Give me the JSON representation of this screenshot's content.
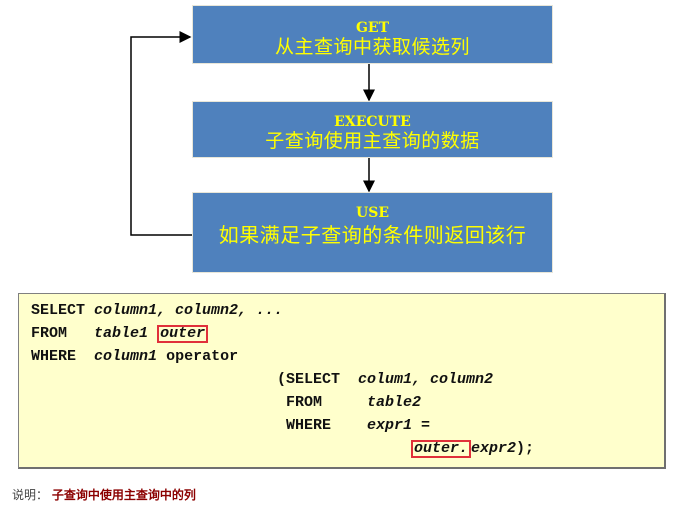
{
  "flow": {
    "steps": [
      {
        "keyword": "GET",
        "description": "从主查询中获取候选列"
      },
      {
        "keyword": "EXECUTE",
        "description": "子查询使用主查询的数据"
      },
      {
        "keyword": "USE",
        "description": "如果满足子查询的条件则返回该行"
      }
    ],
    "colors": {
      "box_fill": "#4f81bd",
      "box_text": "#ffff00",
      "arrow": "#000000"
    }
  },
  "code": {
    "lines": [
      {
        "kw": "SELECT",
        "rest_italic": "column1, column2, ..."
      },
      {
        "kw": "FROM",
        "rest_italic": "table1",
        "highlight": "outer"
      },
      {
        "kw": "WHERE",
        "rest_italic": "column1",
        "rest_plain": "operator"
      },
      {
        "kw": "(SELECT",
        "rest_italic": "colum1, column2"
      },
      {
        "kw": "FROM",
        "rest_italic": "table2"
      },
      {
        "kw": "WHERE",
        "rest_italic": "expr1 ="
      },
      {
        "highlight": "outer.",
        "rest_italic": "expr2",
        "rest_plain": ");"
      }
    ],
    "colors": {
      "background": "#ffffcc",
      "highlight_border": "#e0303a"
    }
  },
  "caption": {
    "label": "说明：",
    "text": "子查询中使用主查询中的列",
    "text_color": "#8b0000"
  }
}
